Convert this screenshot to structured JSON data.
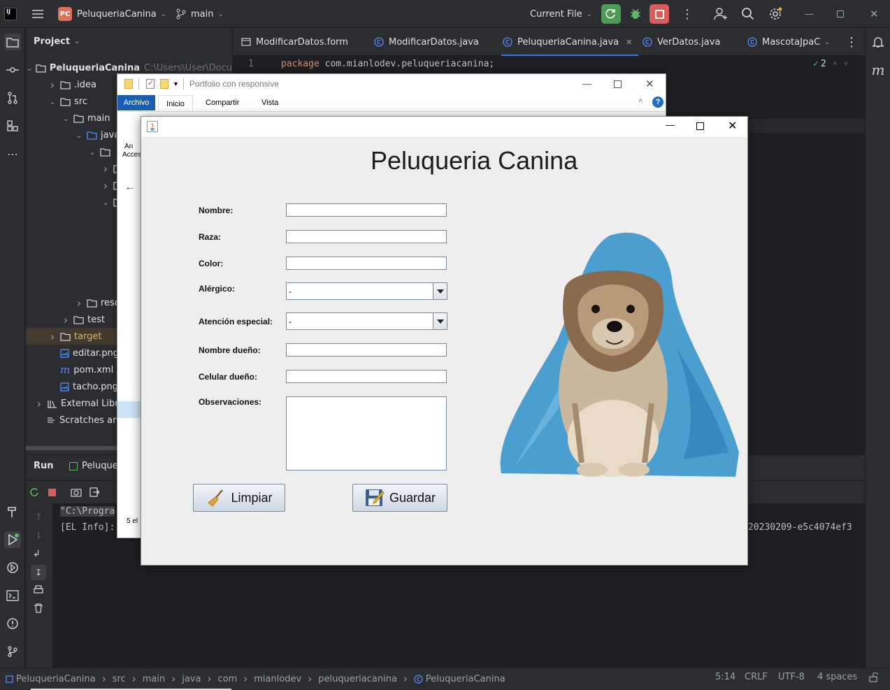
{
  "ide": {
    "project_badge": "PC",
    "project_name": "PeluqueriaCanina",
    "branch": "main",
    "run_config": "Current File",
    "project_tool": "Project",
    "project_path": "C:\\Users\\User\\Docu",
    "tree": [
      {
        "label": "PeluqueriaCanina",
        "indent": 0,
        "arrow": "v",
        "icon": "folder-icon"
      },
      {
        "label": ".idea",
        "indent": 1,
        "arrow": ">",
        "icon": "folder-icon"
      },
      {
        "label": "src",
        "indent": 1,
        "arrow": "v",
        "icon": "folder-icon"
      },
      {
        "label": "main",
        "indent": 2,
        "arrow": "v",
        "icon": "folder-icon"
      },
      {
        "label": "java",
        "indent": 3,
        "arrow": "v",
        "icon": "folder-icon"
      },
      {
        "label": "",
        "indent": 4,
        "arrow": "v",
        "icon": "package-icon"
      },
      {
        "label": "",
        "indent": 5,
        "arrow": ">",
        "icon": "package-icon"
      },
      {
        "label": "",
        "indent": 5,
        "arrow": ">",
        "icon": "package-icon"
      },
      {
        "label": "",
        "indent": 5,
        "arrow": "v",
        "icon": "package-icon"
      },
      {
        "label": "",
        "indent": 6,
        "arrow": "",
        "icon": ""
      },
      {
        "label": "",
        "indent": 6,
        "arrow": "",
        "icon": ""
      },
      {
        "label": "",
        "indent": 6,
        "arrow": "",
        "icon": ""
      },
      {
        "label": "",
        "indent": 6,
        "arrow": "",
        "icon": ""
      },
      {
        "label": "",
        "indent": 6,
        "arrow": "",
        "icon": ""
      },
      {
        "label": "reso",
        "indent": 3,
        "arrow": ">",
        "icon": "folder-icon"
      },
      {
        "label": "test",
        "indent": 2,
        "arrow": ">",
        "icon": "folder-icon"
      },
      {
        "label": "target",
        "indent": 1,
        "arrow": ">",
        "icon": "folder-icon"
      },
      {
        "label": "editar.png",
        "indent": 1,
        "arrow": "",
        "icon": "image-icon"
      },
      {
        "label": "pom.xml",
        "indent": 1,
        "arrow": "",
        "icon": "maven-icon"
      },
      {
        "label": "tacho.png",
        "indent": 1,
        "arrow": "",
        "icon": "image-icon"
      },
      {
        "label": "External Libr",
        "indent": 0,
        "arrow": ">",
        "icon": "library-icon"
      },
      {
        "label": "Scratches an",
        "indent": 0,
        "arrow": "",
        "icon": "scratch-icon"
      }
    ],
    "editor_tabs": [
      {
        "label": "ModificarDatos.form",
        "icon": "form-icon",
        "active": false
      },
      {
        "label": "ModificarDatos.java",
        "icon": "class-icon",
        "active": false
      },
      {
        "label": "PeluqueriaCanina.java",
        "icon": "class-icon",
        "active": true
      },
      {
        "label": "VerDatos.java",
        "icon": "class-icon",
        "active": false
      },
      {
        "label": "MascotaJpaC",
        "icon": "class-icon",
        "active": false
      }
    ],
    "line_number": "1",
    "code_keyword": "package",
    "code_rest": " com.mianlodev.peluqueriacanina;",
    "inspections_count": "2",
    "run_tab": "Run",
    "run_config_tab": "Peluque",
    "console_line1": "\"C:\\Progra",
    "console_line2": "[EL Info]: 202",
    "console_line2_end": "20230209-e5c4074ef3",
    "breadcrumb": [
      "PeluqueriaCanina",
      "src",
      "main",
      "java",
      "com",
      "mianlodev",
      "peluqueriacanina",
      "PeluqueriaCanina"
    ],
    "status_position": "5:14",
    "status_line_ending": "CRLF",
    "status_encoding": "UTF-8",
    "status_indent": "4 spaces"
  },
  "explorer": {
    "title": "Portfolio con responsive",
    "ribbon_tabs": [
      "Archivo",
      "Inicio",
      "Compartir",
      "Vista"
    ],
    "side_text1": "An",
    "side_text2": "Acces",
    "status_text": "5 el"
  },
  "app": {
    "heading": "Peluqueria Canina",
    "fields": {
      "nombre": "Nombre:",
      "raza": "Raza:",
      "color": "Color:",
      "alergico": "Alérgico:",
      "atencion": "Atención especial:",
      "dueno": "Nombre dueño:",
      "celular": "Celular dueño:",
      "observaciones": "Observaciones:"
    },
    "alergico_value": "-",
    "atencion_value": "-",
    "btn_limpiar": "Limpiar",
    "btn_guardar": "Guardar"
  },
  "colors": {
    "accent": "#3574f0",
    "run_green": "#4e9a59",
    "stop_red": "#db5c5c",
    "blanket_blue": "#4a9fd0"
  }
}
